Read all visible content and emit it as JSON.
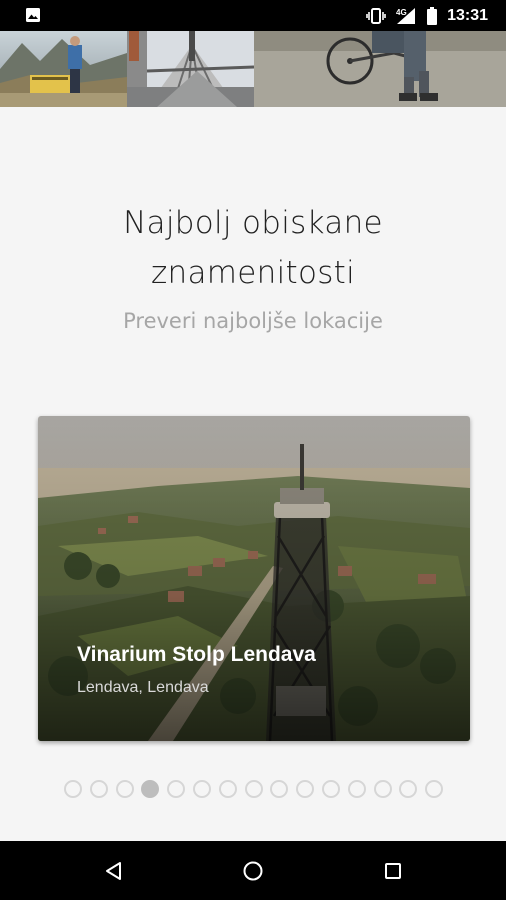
{
  "status_bar": {
    "time": "13:31",
    "network": "4G",
    "icons": [
      "photo-icon",
      "vibrate-icon",
      "signal-icon",
      "battery-icon"
    ]
  },
  "onboarding": {
    "title_line1": "Najbolj obiskane",
    "title_line2": "znamenitosti",
    "subtitle": "Preveri najboljše lokacije"
  },
  "card": {
    "name": "Vinarium Stolp Lendava",
    "location": "Lendava, Lendava"
  },
  "pager": {
    "count": 15,
    "active_index": 3
  },
  "nav_bar": {
    "buttons": [
      "back-icon",
      "home-icon",
      "recents-icon"
    ]
  },
  "colors": {
    "background": "#f5f5f5",
    "title": "#212121",
    "subtitle": "#a6a6a6",
    "dot_inactive": "#d6d6d6",
    "dot_active": "#bdbdbd"
  }
}
